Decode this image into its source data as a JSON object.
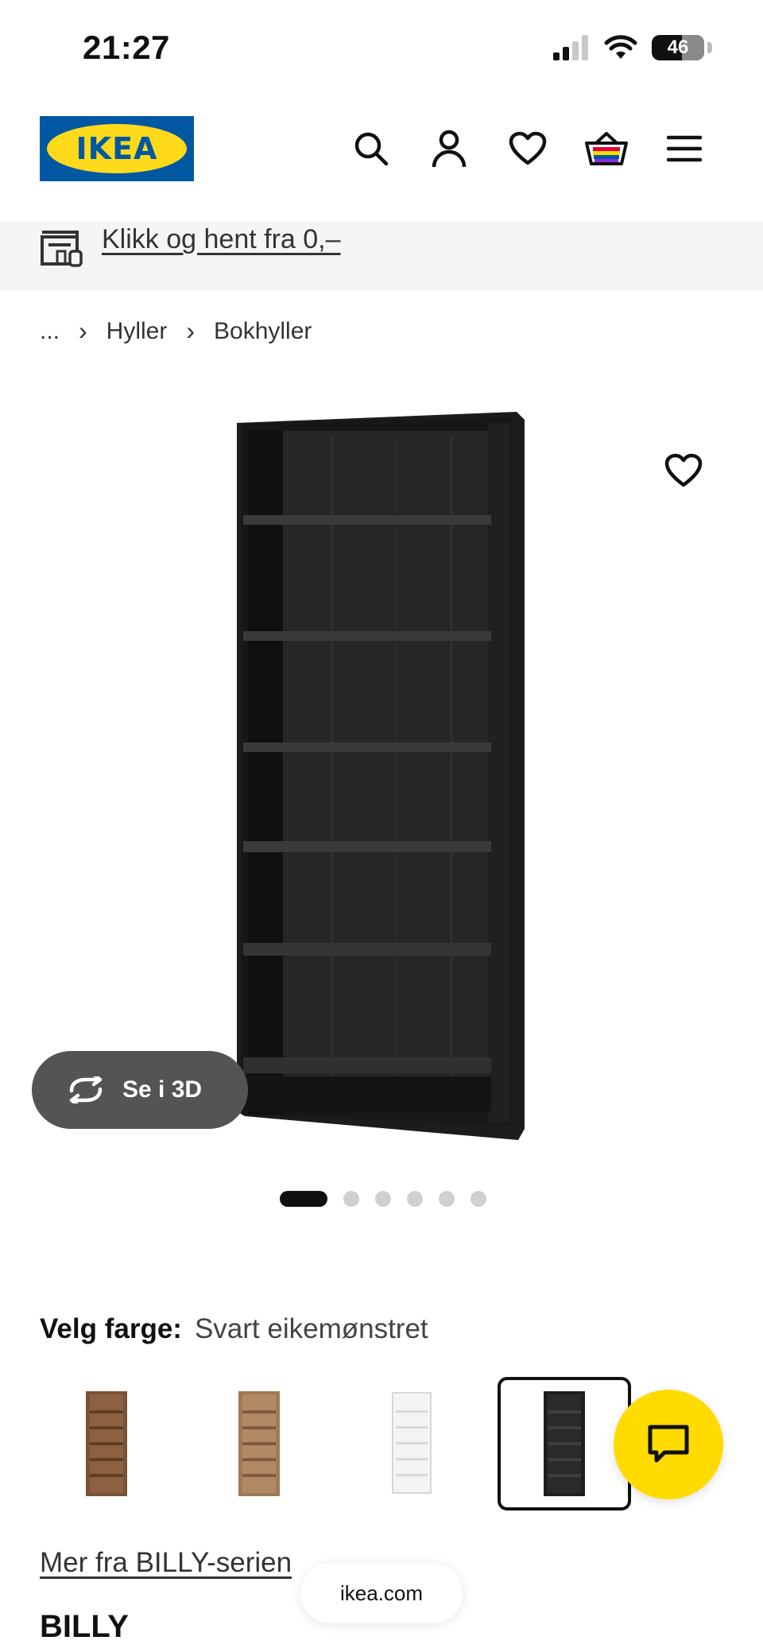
{
  "status_bar": {
    "time": "21:27",
    "battery": "46"
  },
  "header": {
    "logo_text": "IKEA",
    "icons": [
      "search-icon",
      "account-icon",
      "heart-icon",
      "basket-icon",
      "menu-icon"
    ]
  },
  "banner": {
    "text": "Klikk og hent fra 0,–"
  },
  "breadcrumb": {
    "items": [
      "...",
      "Hyller",
      "Bokhyller"
    ]
  },
  "gallery": {
    "see_3d_label": "Se i 3D",
    "dot_count": 6,
    "active_index": 0
  },
  "color": {
    "label": "Velg farge:",
    "selected": "Svart eikemønstret",
    "swatches": [
      {
        "shade": "#7b5236",
        "selected": false
      },
      {
        "shade": "#a07a55",
        "selected": false
      },
      {
        "shade": "#f2f2f2",
        "selected": false
      },
      {
        "shade": "#1e1e1e",
        "selected": true
      }
    ]
  },
  "series_link": "Mer fra BILLY-serien",
  "url": "ikea.com",
  "product": {
    "name": "BILLY"
  },
  "colors": {
    "ikea_blue": "#0058a3",
    "ikea_yellow": "#ffdb00",
    "dark_button": "#545454"
  }
}
